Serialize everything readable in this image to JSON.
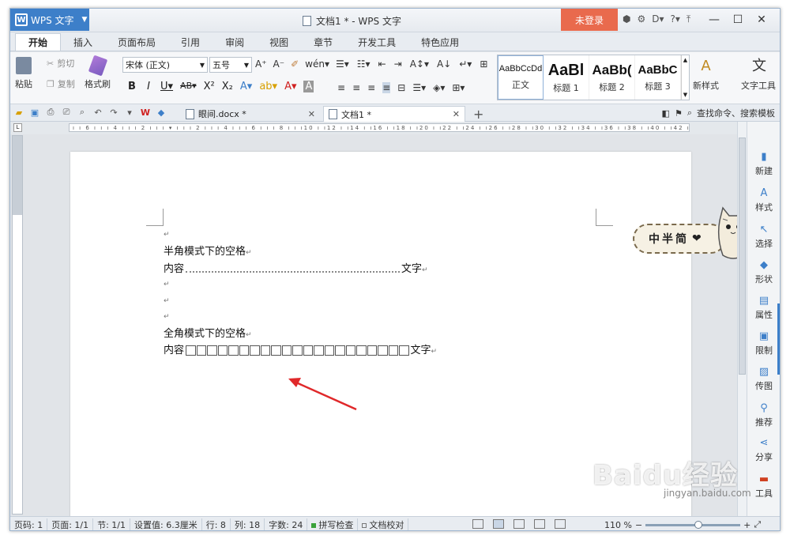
{
  "app": {
    "name": "WPS 文字",
    "window_title": "文档1 * - WPS 文字",
    "login": "未登录"
  },
  "menu_tabs": [
    "开始",
    "插入",
    "页面布局",
    "引用",
    "审阅",
    "视图",
    "章节",
    "开发工具",
    "特色应用"
  ],
  "ribbon": {
    "paste": "粘贴",
    "cut": "剪切",
    "copy": "复制",
    "format_painter": "格式刷",
    "font_name": "宋体 (正文)",
    "font_size": "五号",
    "styles": [
      {
        "sample": "AaBbCcDd",
        "name": "正文"
      },
      {
        "sample": "AaBl",
        "name": "标题 1"
      },
      {
        "sample": "AaBb(",
        "name": "标题 2"
      },
      {
        "sample": "AaBbC",
        "name": "标题 3"
      }
    ],
    "new_style": "新样式",
    "text_tools": "文字工具"
  },
  "doc_tabs": [
    {
      "label": "眼间.docx *"
    },
    {
      "label": "文档1 *"
    }
  ],
  "search": "查找命令、搜索模板",
  "document": {
    "line1": "半角模式下的空格",
    "line2_start": "内容",
    "line2_end": "文字",
    "line3": "全角模式下的空格",
    "line4_start": "内容",
    "line4_end": "文字",
    "full_width_space_count": 21
  },
  "right_panel": [
    "新建",
    "样式",
    "选择",
    "形状",
    "属性",
    "限制",
    "传图",
    "推荐",
    "分享",
    "工具"
  ],
  "sticker": "中半简",
  "status": {
    "page_num": "页码: 1",
    "pages": "页面: 1/1",
    "section": "节: 1/1",
    "setting": "设置值: 6.3厘米",
    "row": "行: 8",
    "col": "列: 18",
    "words": "字数: 24",
    "spell": "拼写检查",
    "proof": "文档校对",
    "zoom": "110 %"
  },
  "watermark": {
    "main": "Baidu经验",
    "sub": "jingyan.baidu.com"
  },
  "colors": {
    "accent": "#3d7fc9",
    "login": "#e96a4d",
    "arrow": "#e0282a"
  }
}
